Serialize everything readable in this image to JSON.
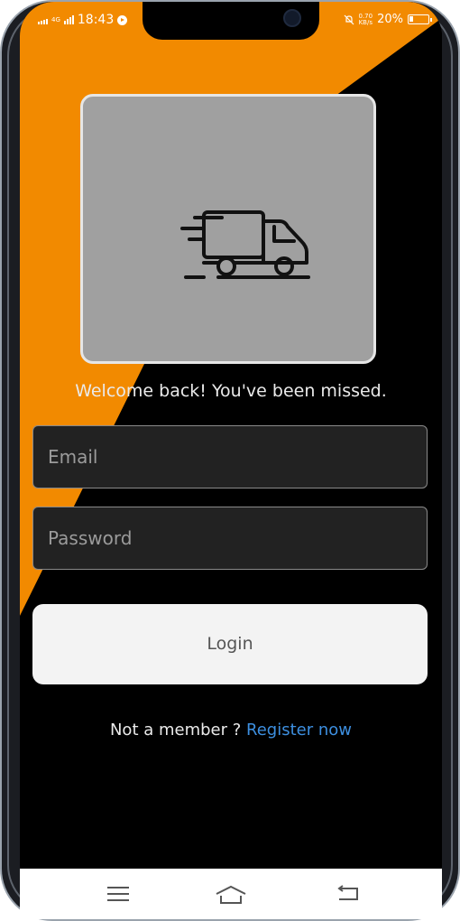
{
  "status_bar": {
    "time": "18:43",
    "network_left": "4G",
    "speed": [
      "0.70",
      "KB/s"
    ],
    "battery": "20%",
    "battery_level": 0.2
  },
  "colors": {
    "accent": "#f28a00",
    "background": "#000000",
    "link": "#3d8fe0",
    "field_background": "#222222",
    "logo_card": "#a0a0a0"
  },
  "logo": {
    "icon": "delivery-truck-icon"
  },
  "welcome_text": "Welcome back! You've been missed.",
  "form": {
    "email_placeholder": "Email",
    "password_placeholder": "Password",
    "login_label": "Login"
  },
  "register": {
    "prompt": "Not a member ?",
    "link_label": "Register now"
  },
  "nav_bar": {
    "icons": [
      "menu-icon",
      "home-icon",
      "back-icon"
    ]
  }
}
